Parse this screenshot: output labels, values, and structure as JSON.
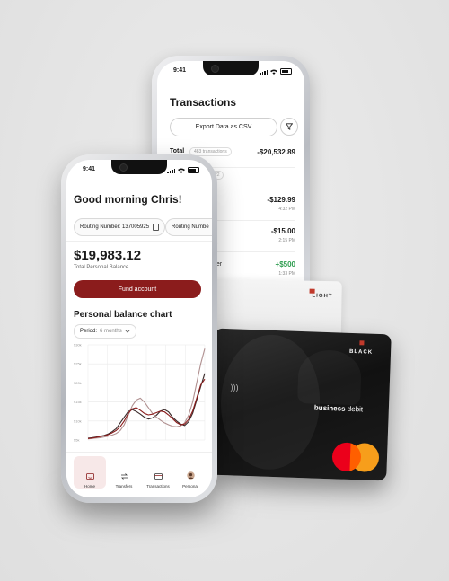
{
  "back_phone": {
    "status_time": "9:41",
    "title": "Transactions",
    "export_label": "Export Data as CSV",
    "total_label": "Total",
    "total_count": "483 transactions",
    "total_amount": "-$20,532.89",
    "transactions": [
      {
        "amount": "-$129.99",
        "time": "4:32 PM",
        "color": "#1a1a1a"
      },
      {
        "amount": "-$15.00",
        "time": "2:15 PM",
        "color": "#1a1a1a"
      },
      {
        "amount": "+$500",
        "time": "1:33 PM",
        "color": "#2e9d4f"
      }
    ],
    "partial_labels": [
      "22",
      "es",
      "ber"
    ]
  },
  "front_phone": {
    "status_time": "9:41",
    "greeting": "Good morning Chris!",
    "routing_1": "Routing Number: 137005925",
    "routing_2": "Routing Numbe",
    "balance": "$19,983.12",
    "balance_label": "Total Personal Balance",
    "fund_button": "Fund account",
    "chart_title": "Personal balance chart",
    "period_label": "Period:",
    "period_value": "6 months",
    "tabs": [
      {
        "label": "Home",
        "icon": "home-icon",
        "active": true
      },
      {
        "label": "Transfers",
        "icon": "transfer-icon",
        "active": false
      },
      {
        "label": "Transactions",
        "icon": "transactions-icon",
        "active": false
      },
      {
        "label": "Personal",
        "icon": "avatar-icon",
        "active": false
      }
    ]
  },
  "cards": {
    "light_label": "LIGHT",
    "black_label": "BLACK",
    "business_bold": "business",
    "business_rest": " debit",
    "brand": "mastercard",
    "accent_color": "#8b1c1c"
  },
  "chart_data": {
    "type": "line",
    "y_ticks": [
      "$30k",
      "$25k",
      "$20k",
      "$15k",
      "$10k",
      "$5k"
    ],
    "ylim": [
      5,
      30
    ],
    "x": [
      0,
      1,
      2,
      3,
      4,
      5,
      6,
      7,
      8,
      9,
      10,
      11,
      12,
      13,
      14,
      15,
      16,
      17,
      18,
      19,
      20,
      21,
      22,
      23,
      24,
      25,
      26,
      27,
      28,
      29
    ],
    "series": [
      {
        "color": "#3a2a2a",
        "values": [
          5.5,
          5.6,
          5.8,
          6.0,
          6.2,
          6.6,
          7.2,
          8.0,
          9.5,
          11.0,
          12.5,
          13.0,
          12.5,
          11.8,
          11.0,
          10.5,
          10.8,
          11.5,
          12.6,
          13.0,
          12.4,
          11.0,
          10.0,
          9.2,
          8.8,
          9.8,
          12.0,
          15.5,
          19.0,
          22.5
        ]
      },
      {
        "color": "#b09090",
        "values": [
          5.3,
          5.4,
          5.5,
          5.6,
          5.8,
          6.0,
          6.3,
          6.7,
          7.5,
          9.0,
          11.5,
          14.0,
          15.5,
          16.0,
          15.0,
          13.5,
          12.0,
          11.0,
          10.2,
          9.5,
          9.0,
          8.6,
          8.5,
          8.7,
          9.5,
          11.5,
          15.0,
          20.0,
          25.0,
          29.0
        ]
      },
      {
        "color": "#8b1c1c",
        "values": [
          5.4,
          5.5,
          5.7,
          5.9,
          6.1,
          6.4,
          6.9,
          7.5,
          8.5,
          10.0,
          12.0,
          13.2,
          13.5,
          12.8,
          12.0,
          11.6,
          11.8,
          12.2,
          12.6,
          12.4,
          11.6,
          10.6,
          9.6,
          9.0,
          9.2,
          10.4,
          12.6,
          16.0,
          19.5,
          21.0
        ]
      }
    ]
  }
}
